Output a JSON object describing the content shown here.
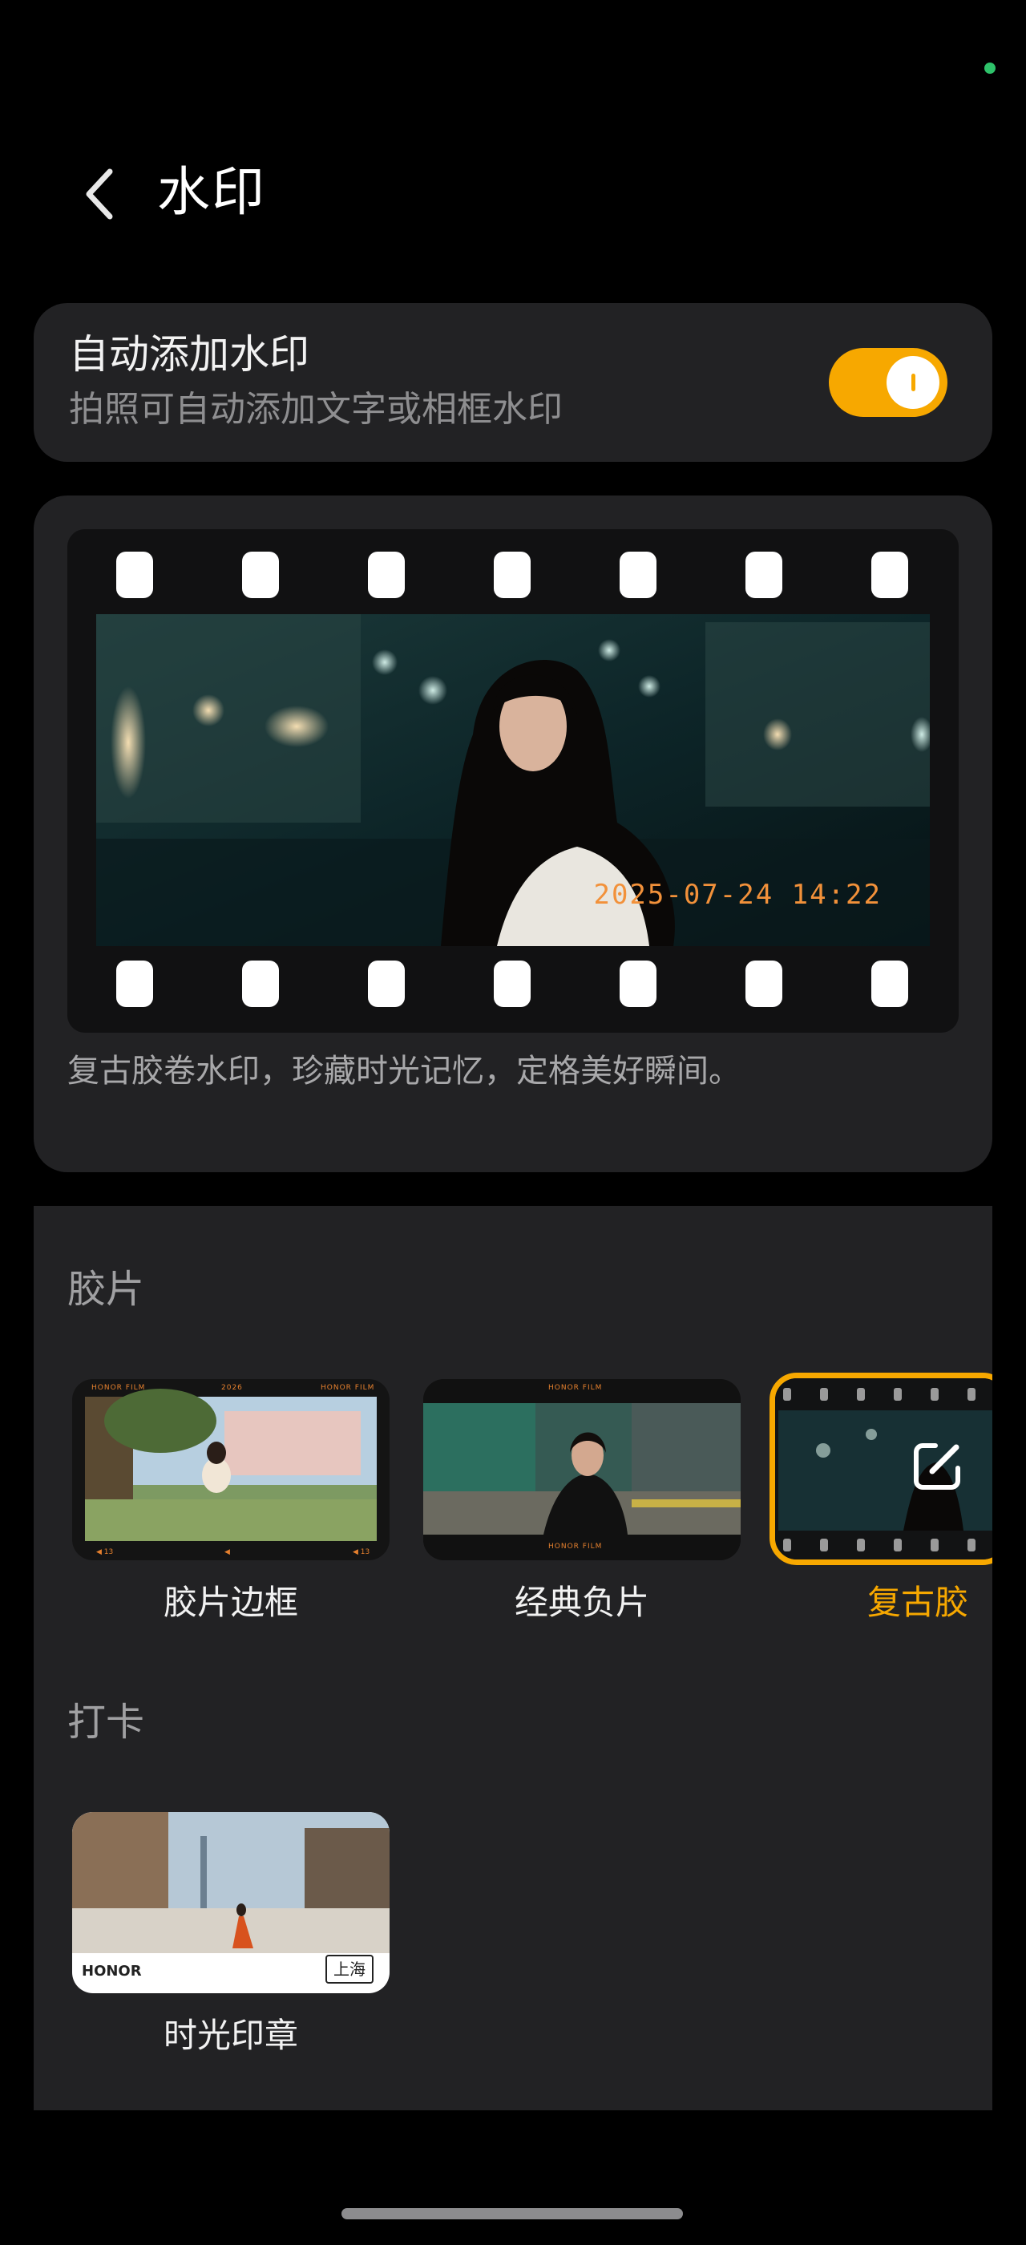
{
  "header": {
    "title": "水印"
  },
  "auto_watermark": {
    "title": "自动添加水印",
    "subtitle": "拍照可自动添加文字或相框水印",
    "enabled": true,
    "accent": "#f7a800"
  },
  "preview": {
    "stamp": "2025-07-24 14:22",
    "description": "复古胶卷水印，珍藏时光记忆，定格美好瞬间。"
  },
  "sections": {
    "film": {
      "title": "胶片",
      "items": [
        {
          "label": "胶片边框",
          "brand": "HONOR FILM",
          "year": "2026"
        },
        {
          "label": "经典负片",
          "brand": "HONOR FILM"
        },
        {
          "label": "复古胶",
          "selected": true
        }
      ]
    },
    "checkin": {
      "title": "打卡",
      "items": [
        {
          "label": "时光印章",
          "brand": "HONOR",
          "seal": "上海"
        }
      ]
    }
  },
  "icons": {
    "back": "chevron-left-icon",
    "edit": "edit-icon"
  }
}
